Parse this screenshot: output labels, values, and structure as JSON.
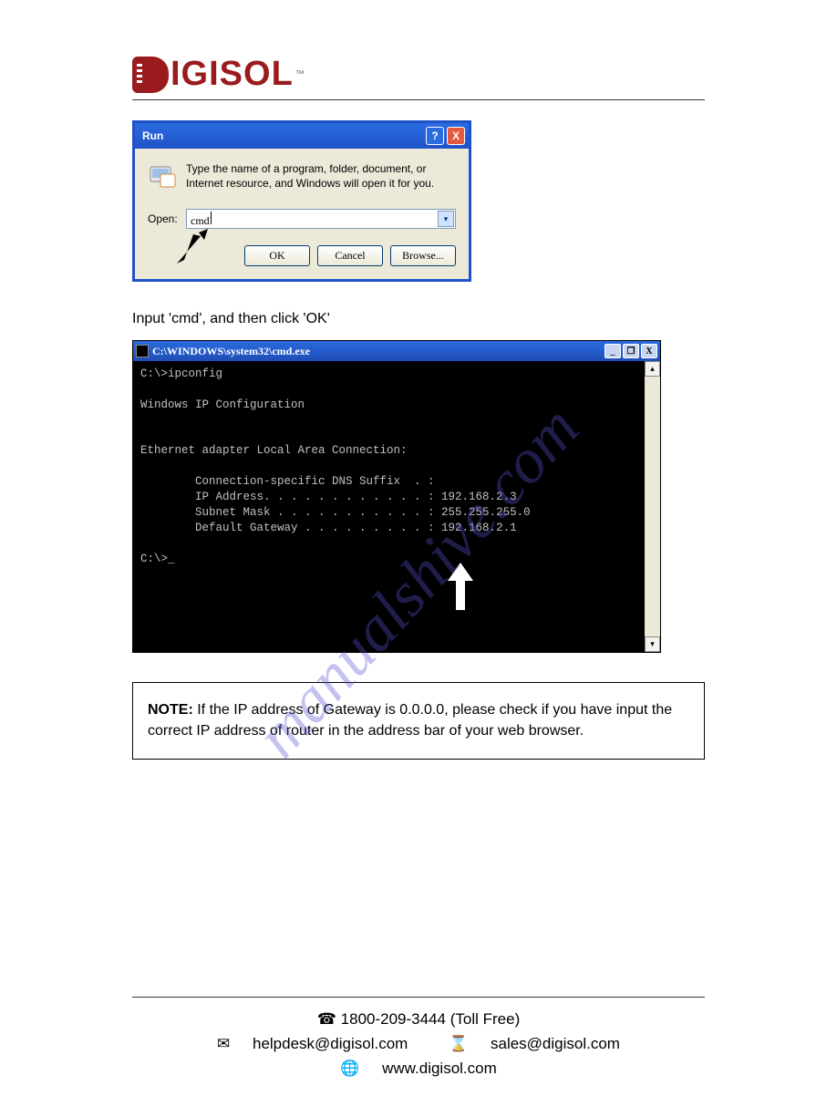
{
  "brand": "IGISOL",
  "watermark_text": "manualshive.com",
  "run_dialog": {
    "title": "Run",
    "description": "Type the name of a program, folder, document, or Internet resource, and Windows will open it for you.",
    "open_label": "Open:",
    "open_value": "cmd",
    "ok_label": "OK",
    "cancel_label": "Cancel",
    "browse_label": "Browse...",
    "help_symbol": "?",
    "close_symbol": "X"
  },
  "intro_text": "Input 'cmd', and then click 'OK'",
  "cmd_window": {
    "title": "C:\\WINDOWS\\system32\\cmd.exe",
    "min_symbol": "_",
    "max_symbol": "❐",
    "close_symbol": "X",
    "lines": {
      "l1": "C:\\>ipconfig",
      "l2": "Windows IP Configuration",
      "l3": "Ethernet adapter Local Area Connection:",
      "l4": "        Connection-specific DNS Suffix  . :",
      "l5": "        IP Address. . . . . . . . . . . . : 192.168.2.3",
      "l6": "        Subnet Mask . . . . . . . . . . . : 255.255.255.0",
      "l7": "        Default Gateway . . . . . . . . . : 192.168.2.1",
      "l8": "C:\\>_"
    }
  },
  "note": {
    "label": "NOTE:",
    "text": " If the IP address of Gateway is 0.0.0.0, please check if you have input the correct IP address of router in the address bar of your web browser."
  },
  "footer": {
    "phone": "1800-209-3444 (Toll Free)",
    "helpdesk": "helpdesk@digisol.com",
    "sales": "sales@digisol.com",
    "web": "www.digisol.com"
  }
}
